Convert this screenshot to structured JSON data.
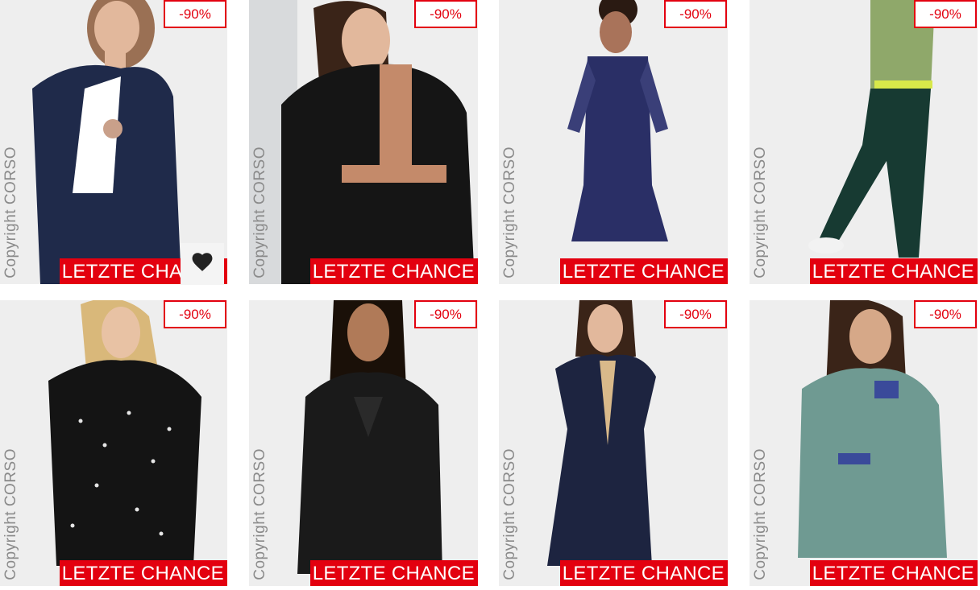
{
  "products": [
    {
      "discount": "-90%",
      "copyright": "Copyright CORSO",
      "promo": "LETZTE CHANCE",
      "garment_color": "#1f2a4a",
      "accent_color": "#ffffff"
    },
    {
      "discount": "-90%",
      "copyright": "Copyright CORSO",
      "promo": "LETZTE CHANCE",
      "garment_color": "#151515",
      "accent_color": "#c48a6a"
    },
    {
      "discount": "-90%",
      "copyright": "Copyright CORSO",
      "promo": "LETZTE CHANCE",
      "garment_color": "#2a2f66",
      "accent_color": "#2a2f66"
    },
    {
      "discount": "-90%",
      "copyright": "Copyright CORSO",
      "promo": "LETZTE CHANCE",
      "garment_color": "#173a32",
      "accent_color": "#6f8a2f"
    },
    {
      "discount": "-90%",
      "copyright": "Copyright CORSO",
      "promo": "LETZTE CHANCE",
      "garment_color": "#141414",
      "accent_color": "#e6e6e6"
    },
    {
      "discount": "-90%",
      "copyright": "Copyright CORSO",
      "promo": "LETZTE CHANCE",
      "garment_color": "#1a1a1a",
      "accent_color": "#1a1a1a"
    },
    {
      "discount": "-90%",
      "copyright": "Copyright CORSO",
      "promo": "LETZTE CHANCE",
      "garment_color": "#1d2440",
      "accent_color": "#d9b98a"
    },
    {
      "discount": "-90%",
      "copyright": "Copyright CORSO",
      "promo": "LETZTE CHANCE",
      "garment_color": "#6f9a92",
      "accent_color": "#3a4a9a"
    }
  ],
  "wishlist": {
    "icon": "heart-icon"
  },
  "colors": {
    "brand_red": "#e3000f",
    "card_bg": "#eeeeee",
    "skin": "#e2b89c",
    "hair_dark": "#3a2418",
    "hair_blonde": "#d9b87a"
  }
}
